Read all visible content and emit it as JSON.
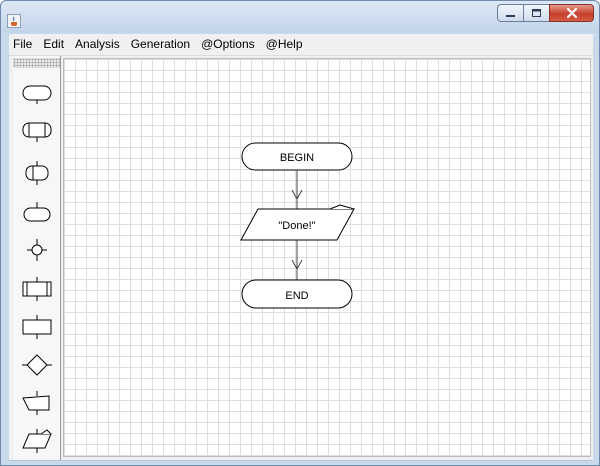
{
  "window": {
    "title": "",
    "app_icon": "java-cup-icon"
  },
  "menu": {
    "items": [
      {
        "label": "File"
      },
      {
        "label": "Edit"
      },
      {
        "label": "Analysis"
      },
      {
        "label": "Generation"
      },
      {
        "label": "@Options"
      },
      {
        "label": "@Help"
      }
    ]
  },
  "palette": {
    "tools": [
      {
        "icon": "terminal-shape-icon"
      },
      {
        "icon": "process-shape-icon"
      },
      {
        "icon": "connector-shape-icon"
      },
      {
        "icon": "terminal-connector-icon"
      },
      {
        "icon": "junction-node-icon"
      },
      {
        "icon": "subroutine-shape-icon"
      },
      {
        "icon": "process-block-icon"
      },
      {
        "icon": "decision-shape-icon"
      },
      {
        "icon": "input-shape-icon"
      },
      {
        "icon": "output-shape-icon"
      }
    ]
  },
  "flowchart": {
    "begin_label": "BEGIN",
    "output_label": "\"Done!\"",
    "end_label": "END"
  },
  "colors": {
    "grid": "#dedede",
    "close_button": "#c4402c",
    "titlebar": "#c9d9ec"
  }
}
